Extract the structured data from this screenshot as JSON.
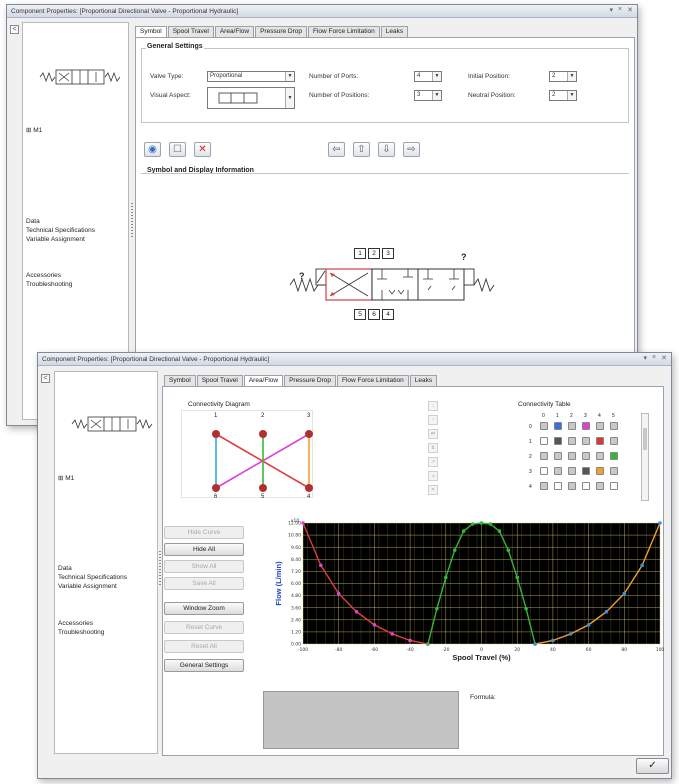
{
  "window1": {
    "title": "Component Properties: [Proportional Directional Valve - Proportional Hydraulic]",
    "title_buttons": [
      "▾",
      "×",
      "✕"
    ],
    "collapse": "<",
    "left_panel": {
      "tree_item": "⊞ M1",
      "sections": [
        "Data",
        "Technical Specifications",
        "Variable Assignment",
        "Accessories",
        "Troubleshooting"
      ]
    },
    "tabs": [
      "Symbol",
      "Spool Travel",
      "Area/Flow",
      "Pressure Drop",
      "Flow Force Limitation",
      "Leaks"
    ],
    "active_tab": "Symbol",
    "general_settings": {
      "title": "General Settings",
      "valve_type_label": "Valve Type:",
      "valve_type_value": "Proportional",
      "visual_aspect_label": "Visual Aspect:",
      "num_ports_label": "Number of Ports:",
      "num_ports_value": "4",
      "num_positions_label": "Number of Positions:",
      "num_positions_value": "3",
      "initial_position_label": "Initial Position:",
      "initial_position_value": "2",
      "neutral_position_label": "Neutral Position:",
      "neutral_position_value": "2"
    },
    "symbol_section_title": "Symbol and Display Information",
    "port_labels_top": [
      "1",
      "2",
      "3"
    ],
    "port_labels_bottom": [
      "5",
      "6",
      "4"
    ],
    "question_mark": "?"
  },
  "window2": {
    "title": "Component Properties: [Proportional Directional Valve - Proportional Hydraulic]",
    "title_buttons": [
      "▾",
      "×",
      "✕"
    ],
    "collapse": "<",
    "left_panel": {
      "tree_item": "⊞ M1",
      "sections": [
        "Data",
        "Technical Specifications",
        "Variable Assignment",
        "Accessories",
        "Troubleshooting"
      ]
    },
    "tabs": [
      "Symbol",
      "Spool Travel",
      "Area/Flow",
      "Pressure Drop",
      "Flow Force Limitation",
      "Leaks"
    ],
    "active_tab": "Area/Flow",
    "connectivity_diagram": {
      "title": "Connectivity Diagram",
      "top_labels": [
        "1",
        "2",
        "3"
      ],
      "bottom_labels": [
        "6",
        "5",
        "4"
      ],
      "colors": {
        "red": "#e0403c",
        "magenta": "#e040d8",
        "blue": "#3ba3e0",
        "green": "#37b53a",
        "orange": "#f0a030",
        "node": "#b03030"
      }
    },
    "connectivity_table": {
      "title": "Connectivity Table",
      "columns": [
        "0",
        "1",
        "2",
        "3",
        "4",
        "5"
      ],
      "rows": [
        "0",
        "1",
        "2",
        "3",
        "4"
      ]
    },
    "side_buttons": [
      {
        "label": "Hide Curve",
        "enabled": false
      },
      {
        "label": "Hide All",
        "enabled": true
      },
      {
        "label": "Show All",
        "enabled": false
      },
      {
        "label": "Save All",
        "enabled": false
      },
      {
        "label": "Window Zoom",
        "enabled": true
      },
      {
        "label": "Reset Curve",
        "enabled": false
      },
      {
        "label": "Reset All",
        "enabled": false
      },
      {
        "label": "General Settings",
        "enabled": true
      }
    ],
    "formula_label": "Formula:",
    "ok_button": "✓"
  },
  "chart_data": {
    "type": "line",
    "xlabel": "Spool Travel (%)",
    "ylabel": "Flow (L/min)",
    "y_multiplier": "x10",
    "xlim": [
      -100,
      100
    ],
    "ylim": [
      0,
      12
    ],
    "x_ticks": [
      "-100",
      "-80",
      "-60",
      "-40",
      "-20",
      "0",
      "20",
      "40",
      "60",
      "80",
      "100"
    ],
    "y_ticks": [
      "0.00",
      "1.20",
      "2.40",
      "3.60",
      "4.80",
      "6.00",
      "7.20",
      "8.40",
      "9.60",
      "10.80",
      "12.00"
    ],
    "background": "#000000",
    "grid": true,
    "series": [
      {
        "color": "#e0403c",
        "marker_color": "#e040d8",
        "x": [
          -100,
          -90,
          -80,
          -70,
          -60,
          -50,
          -40,
          -30
        ],
        "y": [
          12.0,
          7.8,
          5.0,
          3.2,
          1.9,
          1.0,
          0.35,
          0.0
        ]
      },
      {
        "color": "#37b53a",
        "marker_color": "#37b53a",
        "x": [
          -30,
          -25,
          -20,
          -15,
          -10,
          -5,
          0,
          5,
          10,
          15,
          20,
          25,
          30
        ],
        "y": [
          0.0,
          3.5,
          6.6,
          9.3,
          11.2,
          11.9,
          12.0,
          11.9,
          11.2,
          9.3,
          6.6,
          3.5,
          0.0
        ]
      },
      {
        "color": "#f0a030",
        "marker_color": "#3b8fe0",
        "x": [
          30,
          40,
          50,
          60,
          70,
          80,
          90,
          100
        ],
        "y": [
          0.0,
          0.35,
          1.0,
          1.9,
          3.2,
          5.0,
          7.8,
          12.0
        ]
      }
    ]
  }
}
